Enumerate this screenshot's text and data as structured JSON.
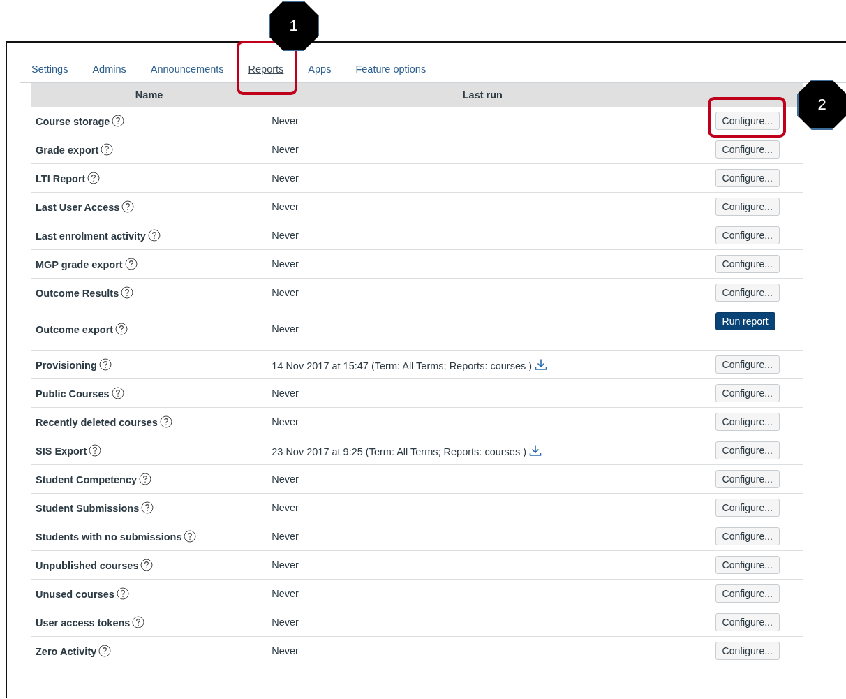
{
  "tabs": [
    {
      "label": "Settings",
      "selected": false
    },
    {
      "label": "Admins",
      "selected": false
    },
    {
      "label": "Announcements",
      "selected": false
    },
    {
      "label": "Reports",
      "selected": true,
      "callout": "1"
    },
    {
      "label": "Apps",
      "selected": false
    },
    {
      "label": "Feature options",
      "selected": false
    }
  ],
  "table": {
    "columns": [
      "Name",
      "Last run"
    ],
    "rows": [
      {
        "name": "Course storage",
        "last_run": "Never",
        "download": false,
        "action": {
          "kind": "configure",
          "label": "Configure...",
          "callout": "2"
        }
      },
      {
        "name": "Grade export",
        "last_run": "Never",
        "download": false,
        "action": {
          "kind": "configure",
          "label": "Configure..."
        }
      },
      {
        "name": "LTI Report",
        "last_run": "Never",
        "download": false,
        "action": {
          "kind": "configure",
          "label": "Configure..."
        }
      },
      {
        "name": "Last User Access",
        "last_run": "Never",
        "download": false,
        "action": {
          "kind": "configure",
          "label": "Configure..."
        }
      },
      {
        "name": "Last enrolment activity",
        "last_run": "Never",
        "download": false,
        "action": {
          "kind": "configure",
          "label": "Configure..."
        }
      },
      {
        "name": "MGP grade export",
        "last_run": "Never",
        "download": false,
        "action": {
          "kind": "configure",
          "label": "Configure..."
        }
      },
      {
        "name": "Outcome Results",
        "last_run": "Never",
        "download": false,
        "action": {
          "kind": "configure",
          "label": "Configure..."
        }
      },
      {
        "name": "Outcome export",
        "last_run": "Never",
        "download": false,
        "action": {
          "kind": "run",
          "label": "Run report"
        }
      },
      {
        "name": "Provisioning",
        "last_run": "14 Nov 2017 at 15:47 (Term: All Terms; Reports: courses )",
        "download": true,
        "action": {
          "kind": "configure",
          "label": "Configure..."
        }
      },
      {
        "name": "Public Courses",
        "last_run": "Never",
        "download": false,
        "action": {
          "kind": "configure",
          "label": "Configure..."
        }
      },
      {
        "name": "Recently deleted courses",
        "last_run": "Never",
        "download": false,
        "action": {
          "kind": "configure",
          "label": "Configure..."
        }
      },
      {
        "name": "SIS Export",
        "last_run": "23 Nov 2017 at 9:25 (Term: All Terms; Reports: courses )",
        "download": true,
        "action": {
          "kind": "configure",
          "label": "Configure..."
        }
      },
      {
        "name": "Student Competency",
        "last_run": "Never",
        "download": false,
        "action": {
          "kind": "configure",
          "label": "Configure..."
        }
      },
      {
        "name": "Student Submissions",
        "last_run": "Never",
        "download": false,
        "action": {
          "kind": "configure",
          "label": "Configure..."
        }
      },
      {
        "name": "Students with no submissions",
        "last_run": "Never",
        "download": false,
        "action": {
          "kind": "configure",
          "label": "Configure..."
        }
      },
      {
        "name": "Unpublished courses",
        "last_run": "Never",
        "download": false,
        "action": {
          "kind": "configure",
          "label": "Configure..."
        }
      },
      {
        "name": "Unused courses",
        "last_run": "Never",
        "download": false,
        "action": {
          "kind": "configure",
          "label": "Configure..."
        }
      },
      {
        "name": "User access tokens",
        "last_run": "Never",
        "download": false,
        "action": {
          "kind": "configure",
          "label": "Configure..."
        }
      },
      {
        "name": "Zero Activity",
        "last_run": "Never",
        "download": false,
        "action": {
          "kind": "configure",
          "label": "Configure..."
        }
      }
    ]
  }
}
